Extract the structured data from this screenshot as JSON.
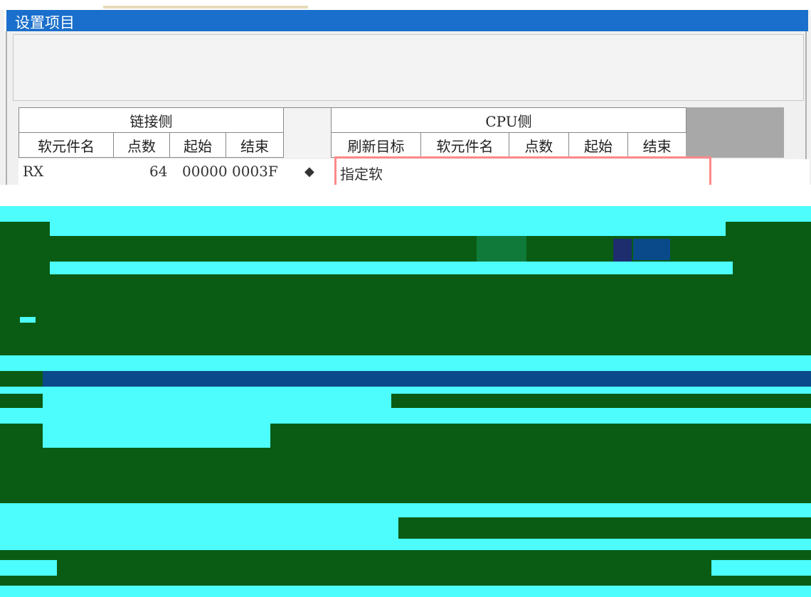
{
  "window": {
    "title": "设置项目"
  },
  "table": {
    "link_group": "链接侧",
    "cpu_group": "CPU侧",
    "link_headers": [
      "软元件名",
      "点数",
      "起始",
      "结束"
    ],
    "cpu_headers": [
      "刷新目标",
      "软元件名",
      "点数",
      "起始",
      "结束"
    ]
  },
  "row": {
    "device": "RX",
    "points": "64",
    "start": "00000",
    "end": "0003F",
    "refresh_target": "指定软"
  },
  "colors": {
    "titlebar": "#1a6fcc",
    "glitch_green": "#0a5c14",
    "glitch_cyan": "#4dfcfc",
    "highlight_border": "#ff8a8a"
  }
}
